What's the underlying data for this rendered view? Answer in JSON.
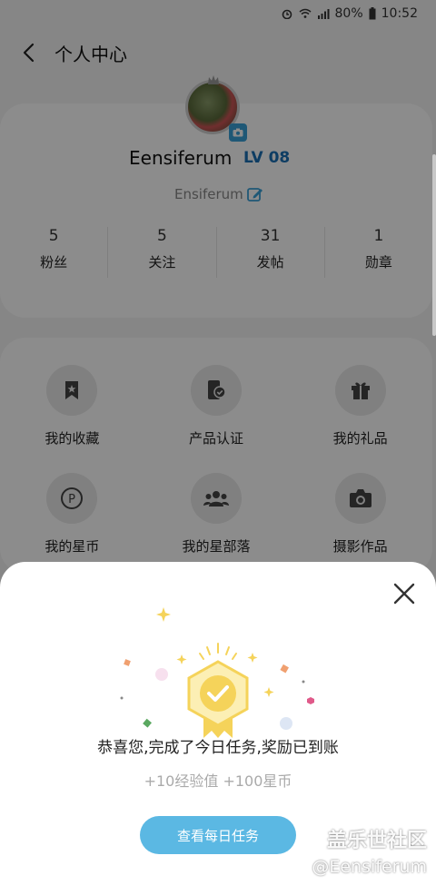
{
  "status_bar": {
    "battery": "80%",
    "time": "10:52"
  },
  "header": {
    "title": "个人中心",
    "back_icon": "chevron-left-icon"
  },
  "profile": {
    "username": "Eensiferum",
    "level": "LV 08",
    "nickname": "Ensiferum",
    "stats": [
      {
        "value": "5",
        "label": "粉丝"
      },
      {
        "value": "5",
        "label": "关注"
      },
      {
        "value": "31",
        "label": "发帖"
      },
      {
        "value": "1",
        "label": "勋章"
      }
    ]
  },
  "menu": [
    {
      "label": "我的收藏",
      "icon": "bookmark-icon"
    },
    {
      "label": "产品认证",
      "icon": "product-verify-icon"
    },
    {
      "label": "我的礼品",
      "icon": "gift-icon"
    },
    {
      "label": "我的星币",
      "icon": "coin-icon"
    },
    {
      "label": "我的星部落",
      "icon": "group-icon"
    },
    {
      "label": "摄影作品",
      "icon": "camera-icon"
    }
  ],
  "dialog": {
    "message": "恭喜您,完成了今日任务,奖励已到账",
    "reward": "+10经验值 +100星币",
    "button": "查看每日任务"
  },
  "watermark": {
    "title": "盖乐世社区",
    "handle": "@Eensiferum"
  },
  "colors": {
    "accent": "#5bb8e3",
    "level": "#1a6fb5",
    "badge": "#f5d35a"
  }
}
